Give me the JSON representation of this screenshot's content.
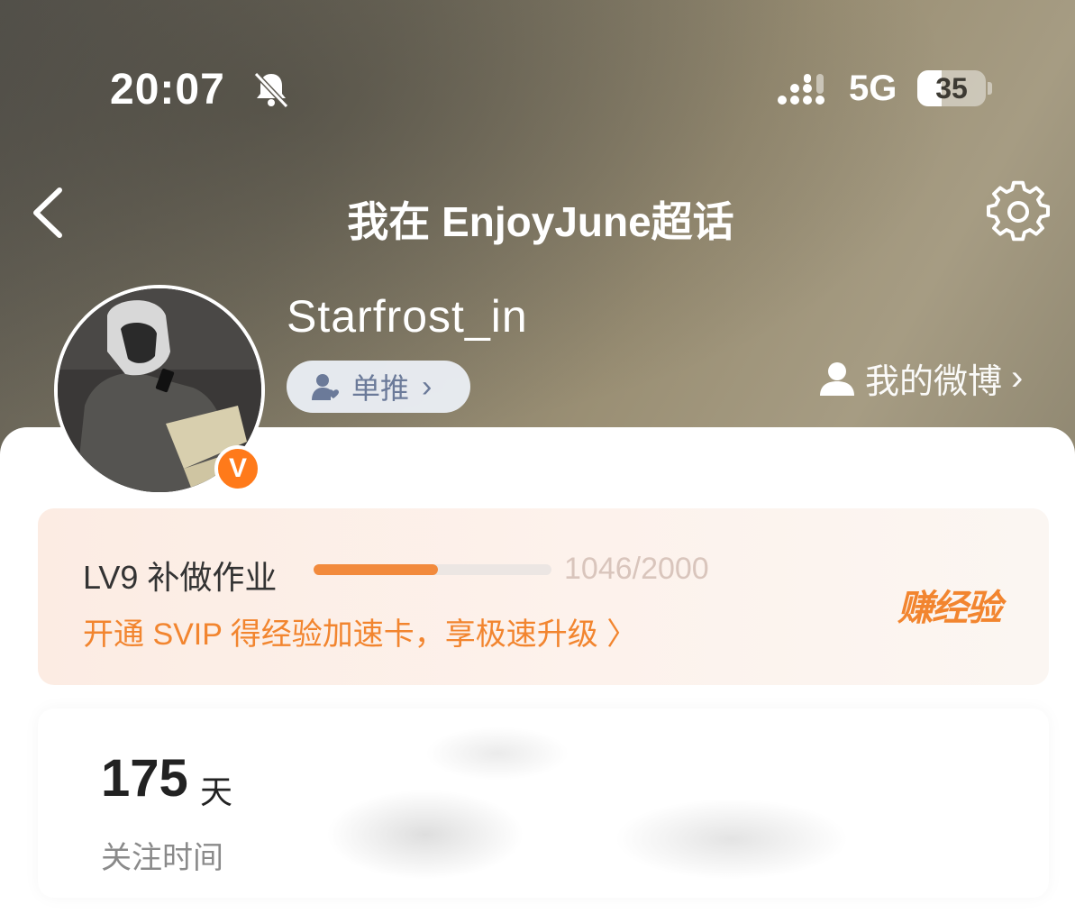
{
  "status_bar": {
    "time": "20:07",
    "network": "5G",
    "battery": "35",
    "battery_level": 0.35,
    "icons": [
      "bell-muted-icon",
      "signal-icon"
    ]
  },
  "nav": {
    "title": "我在 EnjoyJune超话",
    "back_icon": "chevron-left-icon",
    "settings_icon": "gear-icon"
  },
  "profile": {
    "username": "Starfrost_in",
    "tag_label": "单推",
    "my_weibo_label": "我的微博",
    "verified_badge": "V",
    "badge_color": "#ff7a1a"
  },
  "level_card": {
    "level_label": "LV9 补做作业",
    "progress_text": "1046/2000",
    "progress_current": 1046,
    "progress_total": 2000,
    "promo_text": "开通 SVIP 得经验加速卡，享极速升级 〉",
    "earn_exp_label": "赚经验",
    "accent_color": "#f2852f"
  },
  "stats": {
    "value": "175",
    "unit": "天",
    "label": "关注时间"
  }
}
